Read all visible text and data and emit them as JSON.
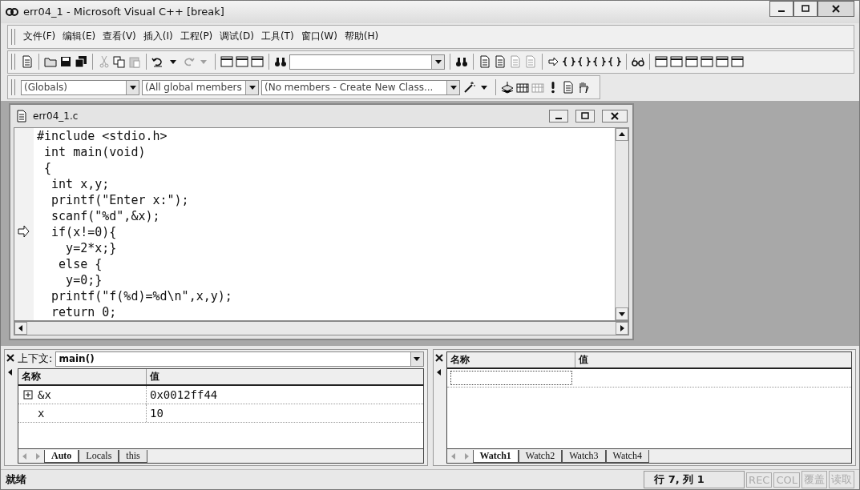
{
  "window": {
    "title": "err04_1 - Microsoft Visual C++ [break]"
  },
  "menu": [
    "文件(F)",
    "编辑(E)",
    "查看(V)",
    "插入(I)",
    "工程(P)",
    "调试(D)",
    "工具(T)",
    "窗口(W)",
    "帮助(H)"
  ],
  "wizard_bar": {
    "class_combo": "(Globals)",
    "filter_combo": "(All global members",
    "members_combo": "(No members - Create New Class..."
  },
  "editor": {
    "title": "err04_1.c",
    "lines": [
      {
        "text": "#include <stdio.h>",
        "current": false
      },
      {
        "text": " int main(void)",
        "current": false
      },
      {
        "text": " {",
        "current": false
      },
      {
        "text": "  int x,y;",
        "current": false
      },
      {
        "text": "  printf(\"Enter x:\");",
        "current": false
      },
      {
        "text": "  scanf(\"%d\",&x);",
        "current": false
      },
      {
        "text": "  if(x!=0){",
        "current": true
      },
      {
        "text": "    y=2*x;}",
        "current": false
      },
      {
        "text": "   else {",
        "current": false
      },
      {
        "text": "    y=0;}",
        "current": false
      },
      {
        "text": "  printf(\"f(%d)=%d\\n\",x,y);",
        "current": false
      },
      {
        "text": "  return 0;",
        "current": false
      }
    ]
  },
  "variables": {
    "context_label": "上下文:",
    "context_value": "main()",
    "columns": [
      "名称",
      "值"
    ],
    "rows": [
      {
        "name": "&x",
        "value": "0x0012ff44",
        "expandable": true
      },
      {
        "name": "x",
        "value": "10",
        "expandable": false
      }
    ],
    "tabs": [
      {
        "label": "Auto",
        "selected": true
      },
      {
        "label": "Locals",
        "selected": false
      },
      {
        "label": "this",
        "selected": false
      }
    ]
  },
  "watch": {
    "columns": [
      "名称",
      "值"
    ],
    "tabs": [
      {
        "label": "Watch1",
        "selected": true
      },
      {
        "label": "Watch2",
        "selected": false
      },
      {
        "label": "Watch3",
        "selected": false
      },
      {
        "label": "Watch4",
        "selected": false
      }
    ]
  },
  "status_bar": {
    "message": "就绪",
    "position": "行 7, 列 1",
    "indicators": [
      {
        "label": "REC",
        "disabled": true
      },
      {
        "label": "COL",
        "disabled": true
      },
      {
        "label": "覆盖",
        "disabled": true
      },
      {
        "label": "读取",
        "disabled": true
      }
    ]
  }
}
